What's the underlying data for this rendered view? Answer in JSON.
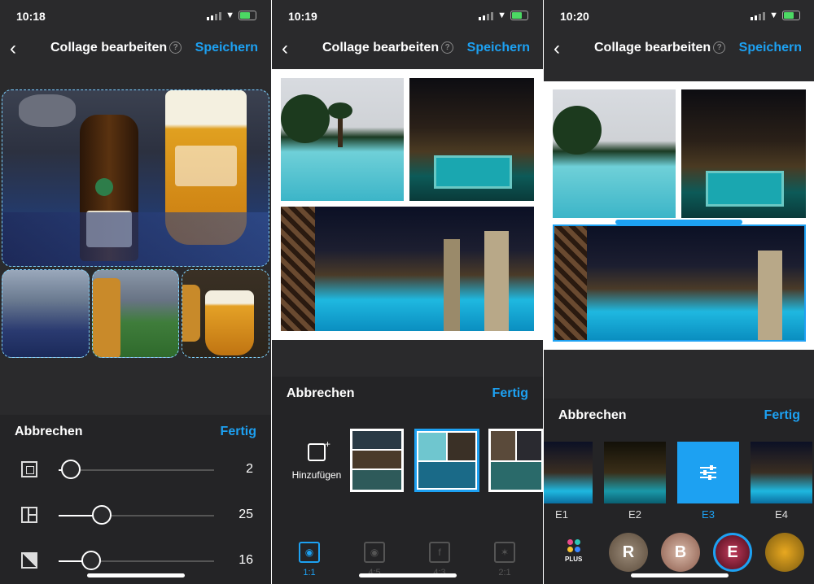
{
  "screens": [
    {
      "time": "10:18",
      "title": "Collage bearbeiten",
      "help": "?",
      "save": "Speichern",
      "cancel": "Abbrechen",
      "done": "Fertig",
      "sliders": [
        {
          "icon": "layout-border-icon",
          "value": "2",
          "fraction": 0.08
        },
        {
          "icon": "layout-spacing-icon",
          "value": "25",
          "fraction": 0.28
        },
        {
          "icon": "corner-radius-icon",
          "value": "16",
          "fraction": 0.21
        }
      ]
    },
    {
      "time": "10:19",
      "title": "Collage bearbeiten",
      "help": "?",
      "save": "Speichern",
      "cancel": "Abbrechen",
      "done": "Fertig",
      "add_label": "Hinzufügen",
      "tabs": [
        {
          "label": "1:1",
          "icon": "instagram-icon",
          "active": true
        },
        {
          "label": "4:5",
          "icon": "instagram-icon",
          "active": false
        },
        {
          "label": "4:3",
          "icon": "facebook-icon",
          "active": false
        },
        {
          "label": "2:1",
          "icon": "twitter-icon",
          "active": false
        }
      ]
    },
    {
      "time": "10:20",
      "title": "Collage bearbeiten",
      "help": "?",
      "save": "Speichern",
      "cancel": "Abbrechen",
      "done": "Fertig",
      "filters": [
        {
          "label": "E1",
          "selected": false
        },
        {
          "label": "E2",
          "selected": false
        },
        {
          "label": "E3",
          "selected": true
        },
        {
          "label": "E4",
          "selected": false
        }
      ],
      "plus_label": "PLUS",
      "presets": [
        "R",
        "B",
        "E"
      ]
    }
  ],
  "colors": {
    "accent": "#1da1f2",
    "background": "#2a2a2c"
  }
}
